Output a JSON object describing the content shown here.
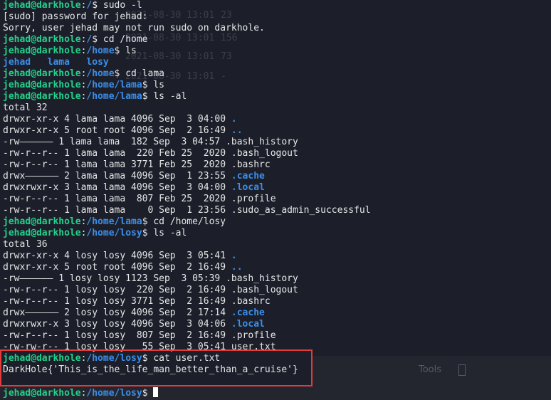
{
  "prompt": {
    "user": "jehad@darkhole",
    "sep": ":",
    "end": "$ "
  },
  "lines": [
    {
      "type": "prompt",
      "path": "/",
      "cmd": "sudo -l"
    },
    {
      "type": "out",
      "text": "[sudo] password for jehad:"
    },
    {
      "type": "out",
      "text": "Sorry, user jehad may not run sudo on darkhole."
    },
    {
      "type": "prompt",
      "path": "/",
      "cmd": "cd /home"
    },
    {
      "type": "prompt",
      "path": "/home",
      "cmd": "ls"
    },
    {
      "type": "dirs",
      "items": [
        "jehad",
        "lama",
        "losy"
      ]
    },
    {
      "type": "prompt",
      "path": "/home",
      "cmd": "cd lama"
    },
    {
      "type": "prompt",
      "path": "/home/lama",
      "cmd": "ls"
    },
    {
      "type": "prompt",
      "path": "/home/lama",
      "cmd": "ls -al"
    },
    {
      "type": "out",
      "text": "total 32"
    },
    {
      "type": "ls",
      "text": "drwxr-xr-x 4 lama lama 4096 Sep  3 04:00 ",
      "name": ".",
      "dir": true
    },
    {
      "type": "ls",
      "text": "drwxr-xr-x 5 root root 4096 Sep  2 16:49 ",
      "name": "..",
      "dir": true
    },
    {
      "type": "ls",
      "text": "-rw—————— 1 lama lama  182 Sep  3 04:57 ",
      "name": ".bash_history",
      "dir": false
    },
    {
      "type": "ls",
      "text": "-rw-r--r-- 1 lama lama  220 Feb 25  2020 ",
      "name": ".bash_logout",
      "dir": false
    },
    {
      "type": "ls",
      "text": "-rw-r--r-- 1 lama lama 3771 Feb 25  2020 ",
      "name": ".bashrc",
      "dir": false
    },
    {
      "type": "ls",
      "text": "drwx—————— 2 lama lama 4096 Sep  1 23:55 ",
      "name": ".cache",
      "dir": true
    },
    {
      "type": "ls",
      "text": "drwxrwxr-x 3 lama lama 4096 Sep  3 04:00 ",
      "name": ".local",
      "dir": true
    },
    {
      "type": "ls",
      "text": "-rw-r--r-- 1 lama lama  807 Feb 25  2020 ",
      "name": ".profile",
      "dir": false
    },
    {
      "type": "ls",
      "text": "-rw-r--r-- 1 lama lama    0 Sep  1 23:56 ",
      "name": ".sudo_as_admin_successful",
      "dir": false
    },
    {
      "type": "prompt",
      "path": "/home/lama",
      "cmd": "cd /home/losy"
    },
    {
      "type": "prompt",
      "path": "/home/losy",
      "cmd": "ls -al"
    },
    {
      "type": "out",
      "text": "total 36"
    },
    {
      "type": "ls",
      "text": "drwxr-xr-x 4 losy losy 4096 Sep  3 05:41 ",
      "name": ".",
      "dir": true
    },
    {
      "type": "ls",
      "text": "drwxr-xr-x 5 root root 4096 Sep  2 16:49 ",
      "name": "..",
      "dir": true
    },
    {
      "type": "ls",
      "text": "-rw—————— 1 losy losy 1123 Sep  3 05:39 ",
      "name": ".bash_history",
      "dir": false
    },
    {
      "type": "ls",
      "text": "-rw-r--r-- 1 losy losy  220 Sep  2 16:49 ",
      "name": ".bash_logout",
      "dir": false
    },
    {
      "type": "ls",
      "text": "-rw-r--r-- 1 losy losy 3771 Sep  2 16:49 ",
      "name": ".bashrc",
      "dir": false
    },
    {
      "type": "ls",
      "text": "drwx—————— 2 losy losy 4096 Sep  2 17:14 ",
      "name": ".cache",
      "dir": true
    },
    {
      "type": "ls",
      "text": "drwxrwxr-x 3 losy losy 4096 Sep  3 04:06 ",
      "name": ".local",
      "dir": true
    },
    {
      "type": "ls",
      "text": "-rw-r--r-- 1 losy losy  807 Sep  2 16:49 ",
      "name": ".profile",
      "dir": false
    },
    {
      "type": "ls",
      "text": "-rw-rw-r-- 1 losy losy   55 Sep  3 05:41 ",
      "name": "user.txt",
      "dir": false
    },
    {
      "type": "prompt",
      "path": "/home/losy",
      "cmd": "cat user.txt"
    },
    {
      "type": "out",
      "text": "DarkHole{'This_is_the_life_man_better_than_a_cruise'}"
    },
    {
      "type": "blank"
    },
    {
      "type": "prompt",
      "path": "/home/losy",
      "cmd": "",
      "cursor": true
    }
  ],
  "ghost": {
    "times": [
      "2021-08-30 13:01",
      "2021-08-30 13:01",
      "2021-08-30 13:01",
      "2021-08-30 13:01"
    ],
    "sizes": [
      "23",
      "156",
      "73",
      "-"
    ],
    "tools_label": "Tools"
  }
}
